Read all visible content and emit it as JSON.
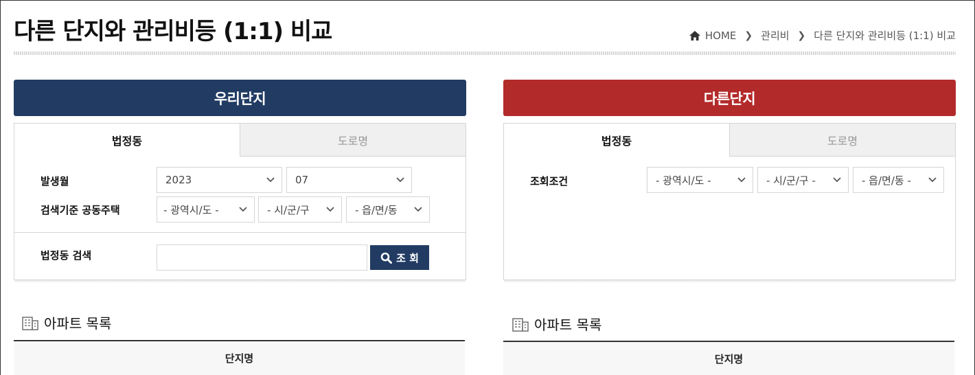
{
  "page": {
    "title": "다른 단지와 관리비등 (1:1) 비교"
  },
  "breadcrumb": {
    "home": "HOME",
    "level1": "관리비",
    "level2": "다른 단지와 관리비등 (1:1) 비교"
  },
  "our_complex": {
    "header": "우리단지",
    "tabs": [
      {
        "label": "법정동"
      },
      {
        "label": "도로명"
      }
    ],
    "occurrence_label": "발생월",
    "year": "2023",
    "month": "07",
    "criteria_label": "검색기준 공동주택",
    "province_placeholder": "- 광역시/도 -",
    "city_placeholder": "- 시/군/구",
    "town_placeholder": "- 읍/면/동",
    "search_label": "법정동 검색",
    "search_value": "",
    "search_button": "조 회"
  },
  "other_complex": {
    "header": "다른단지",
    "tabs": [
      {
        "label": "법정동"
      },
      {
        "label": "도로명"
      }
    ],
    "criteria_label": "조회조건",
    "province_placeholder": "- 광역시/도 -",
    "city_placeholder": "- 시/군/구 -",
    "town_placeholder": "- 읍/면/동 -"
  },
  "apartment_list": {
    "title": "아파트 목록",
    "column": "단지명"
  },
  "colors": {
    "our_header": "#213b63",
    "other_header": "#b32a2a",
    "search_button": "#213b63"
  }
}
